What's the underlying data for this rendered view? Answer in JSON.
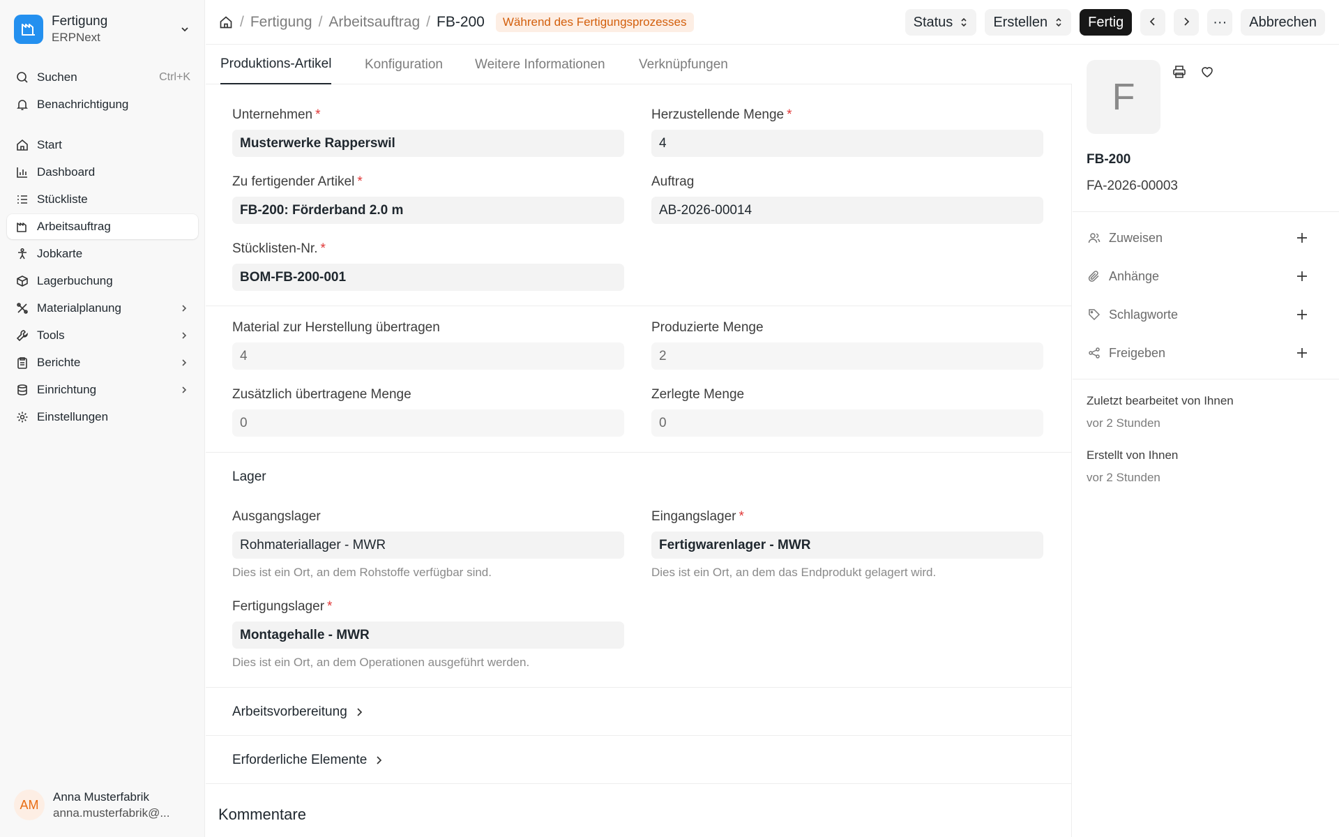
{
  "app": {
    "title": "Fertigung",
    "subtitle": "ERPNext",
    "brand_color": "#2490ef"
  },
  "sidebar": {
    "top_items": [
      {
        "label": "Suchen",
        "hint": "Ctrl+K",
        "icon": "search-icon"
      },
      {
        "label": "Benachrichtigung",
        "icon": "bell-icon"
      }
    ],
    "items": [
      {
        "label": "Start",
        "icon": "home-icon"
      },
      {
        "label": "Dashboard",
        "icon": "bar-chart-icon"
      },
      {
        "label": "Stückliste",
        "icon": "list-icon"
      },
      {
        "label": "Arbeitsauftrag",
        "icon": "factory-icon",
        "active": true
      },
      {
        "label": "Jobkarte",
        "icon": "person-icon"
      },
      {
        "label": "Lagerbuchung",
        "icon": "box-icon"
      },
      {
        "label": "Materialplanung",
        "icon": "tools-icon",
        "has_children": true
      },
      {
        "label": "Tools",
        "icon": "wrench-icon",
        "has_children": true
      },
      {
        "label": "Berichte",
        "icon": "clipboard-icon",
        "has_children": true
      },
      {
        "label": "Einrichtung",
        "icon": "database-icon",
        "has_children": true
      },
      {
        "label": "Einstellungen",
        "icon": "gear-icon"
      }
    ]
  },
  "user": {
    "initials": "AM",
    "name": "Anna Musterfabrik",
    "email": "anna.musterfabrik@..."
  },
  "header": {
    "breadcrumb": [
      "Fertigung",
      "Arbeitsauftrag",
      "FB-200"
    ],
    "status": "Während des Fertigungsprozesses",
    "status_color": "#d35f0c",
    "actions": {
      "status": "Status",
      "create": "Erstellen",
      "finish": "Fertig",
      "more": "···",
      "cancel": "Abbrechen"
    }
  },
  "tabs": [
    "Produktions-Artikel",
    "Konfiguration",
    "Weitere Informationen",
    "Verknüpfungen"
  ],
  "form": {
    "company": {
      "label": "Unternehmen",
      "value": "Musterwerke Rapperswil"
    },
    "qty": {
      "label": "Herzustellende Menge",
      "value": "4"
    },
    "item": {
      "label": "Zu fertigender Artikel",
      "value": "FB-200: Förderband 2.0 m"
    },
    "order": {
      "label": "Auftrag",
      "value": "AB-2026-00014"
    },
    "bom": {
      "label": "Stücklisten-Nr.",
      "value": "BOM-FB-200-001"
    },
    "material_transferred": {
      "label": "Material zur Herstellung übertragen",
      "value": "4"
    },
    "produced_qty": {
      "label": "Produzierte Menge",
      "value": "2"
    },
    "additional_transferred": {
      "label": "Zusätzlich übertragene Menge",
      "value": "0"
    },
    "disassembled_qty": {
      "label": "Zerlegte Menge",
      "value": "0"
    },
    "warehouse_section": "Lager",
    "source_warehouse": {
      "label": "Ausgangslager",
      "value": "Rohmateriallager - MWR",
      "desc": "Dies ist ein Ort, an dem Rohstoffe verfügbar sind."
    },
    "target_warehouse": {
      "label": "Eingangslager",
      "value": "Fertigwarenlager - MWR",
      "desc": "Dies ist ein Ort, an dem das Endprodukt gelagert wird."
    },
    "wip_warehouse": {
      "label": "Fertigungslager",
      "value": "Montagehalle - MWR",
      "desc": "Dies ist ein Ort, an dem Operationen ausgeführt werden."
    },
    "operations_section": "Arbeitsvorbereitung",
    "required_items_section": "Erforderliche Elemente",
    "comments_title": "Kommentare"
  },
  "right_panel": {
    "avatar_letter": "F",
    "doc_name": "FB-200",
    "doc_id": "FA-2026-00003",
    "rows": [
      {
        "label": "Zuweisen",
        "icon": "users-icon"
      },
      {
        "label": "Anhänge",
        "icon": "paperclip-icon"
      },
      {
        "label": "Schlagworte",
        "icon": "tag-icon"
      },
      {
        "label": "Freigeben",
        "icon": "share-icon"
      }
    ],
    "activity": [
      {
        "text": "Zuletzt bearbeitet von Ihnen",
        "time": "vor 2 Stunden"
      },
      {
        "text": "Erstellt von Ihnen",
        "time": "vor 2 Stunden"
      }
    ]
  }
}
